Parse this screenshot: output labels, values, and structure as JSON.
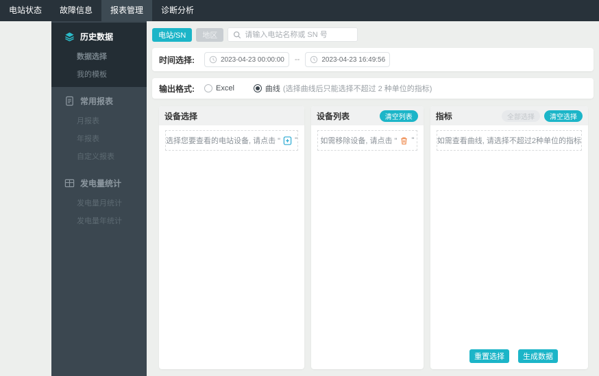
{
  "nav": {
    "items": [
      {
        "label": "电站状态",
        "active": false
      },
      {
        "label": "故障信息",
        "active": false
      },
      {
        "label": "报表管理",
        "active": true
      },
      {
        "label": "诊断分析",
        "active": false
      }
    ]
  },
  "sidebar": {
    "sections": [
      {
        "title": "历史数据",
        "icon": "layers-icon",
        "active": true,
        "items": [
          {
            "label": "数据选择",
            "active": true
          },
          {
            "label": "我的模板",
            "active": false
          }
        ]
      },
      {
        "title": "常用报表",
        "icon": "report-icon",
        "active": false,
        "items": [
          {
            "label": "月报表",
            "active": false
          },
          {
            "label": "年报表",
            "active": false
          },
          {
            "label": "自定义报表",
            "active": false
          }
        ]
      },
      {
        "title": "发电量统计",
        "icon": "grid-icon",
        "active": false,
        "items": [
          {
            "label": "发电量月统计",
            "active": false
          },
          {
            "label": "发电量年统计",
            "active": false
          }
        ]
      }
    ]
  },
  "filter": {
    "station_button": "电站/SN",
    "region_button": "地区",
    "search_placeholder": "请输入电站名称或 SN 号",
    "search_icon": "search-icon"
  },
  "time": {
    "label": "时间选择:",
    "start": "2023-04-23 00:00:00",
    "separator": "--",
    "end": "2023-04-23 16:49:56",
    "icon": "clock-icon"
  },
  "format": {
    "label": "输出格式:",
    "options": [
      {
        "label": "Excel",
        "selected": false
      },
      {
        "label": "曲线",
        "selected": true
      }
    ],
    "note": "(选择曲线后只能选择不超过 2 种单位的指标)"
  },
  "panels": {
    "device_select": {
      "title": "设备选择",
      "hint_prefix": "选择您要查看的电站设备, 请点击 \"",
      "hint_icon": "add-device-icon",
      "hint_suffix": "\""
    },
    "device_list": {
      "title": "设备列表",
      "clear_button": "清空列表",
      "hint_prefix": "如需移除设备, 请点击 \"",
      "hint_icon": "trash-icon",
      "hint_suffix": "\""
    },
    "metrics": {
      "title": "指标",
      "select_all_button": "全部选择",
      "clear_button": "清空选择",
      "hint": "如需查看曲线, 请选择不超过2种单位的指标"
    }
  },
  "actions": {
    "reset": "重置选择",
    "generate": "生成数据"
  },
  "colors": {
    "accent_teal": "#1cb5c8",
    "icon_teal": "#2bbcca",
    "trash_orange": "#ee8a4e",
    "nav_bg": "#28323a",
    "nav_active_bg": "#3d4a53",
    "sidebar_bg": "#3b4750",
    "sidebar_active_bg": "#232d34",
    "page_bg": "#edefed",
    "panel_header_bg": "#f0f1f1"
  }
}
